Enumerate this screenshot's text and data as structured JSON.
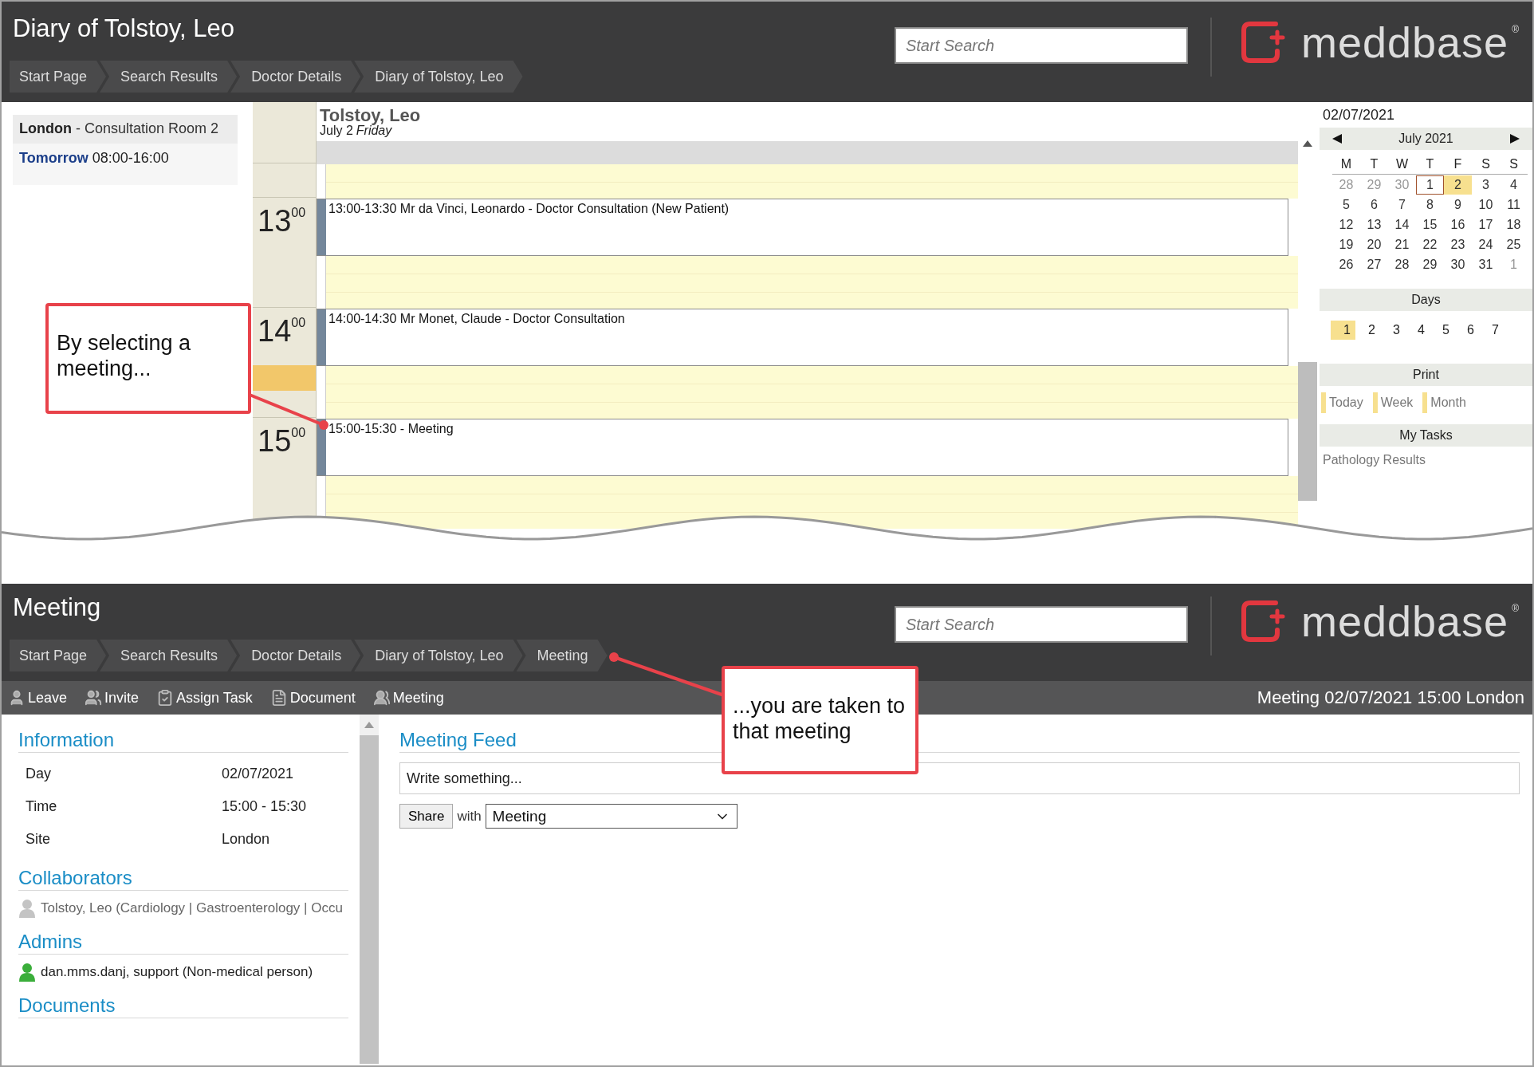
{
  "diary": {
    "title": "Diary of Tolstoy, Leo",
    "breadcrumbs": [
      "Start Page",
      "Search Results",
      "Doctor Details",
      "Diary of Tolstoy, Leo"
    ],
    "search": {
      "placeholder": "Start Search"
    },
    "logo": {
      "text": "meddbase",
      "mark": "®"
    },
    "location": {
      "site": "London",
      "room": "- Consultation Room 2"
    },
    "availability": {
      "day": "Tomorrow",
      "hours": "08:00-16:00"
    },
    "doctor": {
      "name": "Tolstoy, Leo",
      "date": "July 2",
      "weekday": "Friday"
    },
    "hours": [
      {
        "hour": "13",
        "minutes": "00",
        "slots": [
          {
            "appointment": "13:00-13:30 Mr da Vinci, Leonardo - Doctor Consultation (New Patient)",
            "current": false
          },
          {
            "current": false
          }
        ]
      },
      {
        "hour": "14",
        "minutes": "00",
        "slots": [
          {
            "appointment": "14:00-14:30 Mr Monet, Claude - Doctor Consultation",
            "current": false
          },
          {
            "current": true
          }
        ]
      },
      {
        "hour": "15",
        "minutes": "00",
        "slots": [
          {
            "appointment": "15:00-15:30 - Meeting",
            "current": false
          },
          {
            "current": false
          }
        ]
      }
    ],
    "calendar": {
      "date": "02/07/2021",
      "month": "July 2021",
      "weekdays": [
        "M",
        "T",
        "W",
        "T",
        "F",
        "S",
        "S"
      ],
      "weeks": [
        {
          "days": [
            {
              "day": "28",
              "other_month": true,
              "today": false,
              "selected": false
            },
            {
              "day": "29",
              "other_month": true,
              "today": false,
              "selected": false
            },
            {
              "day": "30",
              "other_month": true,
              "today": false,
              "selected": false
            },
            {
              "day": "1",
              "other_month": false,
              "today": true,
              "selected": false
            },
            {
              "day": "2",
              "other_month": false,
              "today": false,
              "selected": true
            },
            {
              "day": "3",
              "other_month": false,
              "today": false,
              "selected": false
            },
            {
              "day": "4",
              "other_month": false,
              "today": false,
              "selected": false
            }
          ]
        },
        {
          "days": [
            {
              "day": "5",
              "other_month": false,
              "today": false,
              "selected": false
            },
            {
              "day": "6",
              "other_month": false,
              "today": false,
              "selected": false
            },
            {
              "day": "7",
              "other_month": false,
              "today": false,
              "selected": false
            },
            {
              "day": "8",
              "other_month": false,
              "today": false,
              "selected": false
            },
            {
              "day": "9",
              "other_month": false,
              "today": false,
              "selected": false
            },
            {
              "day": "10",
              "other_month": false,
              "today": false,
              "selected": false
            },
            {
              "day": "11",
              "other_month": false,
              "today": false,
              "selected": false
            }
          ]
        },
        {
          "days": [
            {
              "day": "12",
              "other_month": false,
              "today": false,
              "selected": false
            },
            {
              "day": "13",
              "other_month": false,
              "today": false,
              "selected": false
            },
            {
              "day": "14",
              "other_month": false,
              "today": false,
              "selected": false
            },
            {
              "day": "15",
              "other_month": false,
              "today": false,
              "selected": false
            },
            {
              "day": "16",
              "other_month": false,
              "today": false,
              "selected": false
            },
            {
              "day": "17",
              "other_month": false,
              "today": false,
              "selected": false
            },
            {
              "day": "18",
              "other_month": false,
              "today": false,
              "selected": false
            }
          ]
        },
        {
          "days": [
            {
              "day": "19",
              "other_month": false,
              "today": false,
              "selected": false
            },
            {
              "day": "20",
              "other_month": false,
              "today": false,
              "selected": false
            },
            {
              "day": "21",
              "other_month": false,
              "today": false,
              "selected": false
            },
            {
              "day": "22",
              "other_month": false,
              "today": false,
              "selected": false
            },
            {
              "day": "23",
              "other_month": false,
              "today": false,
              "selected": false
            },
            {
              "day": "24",
              "other_month": false,
              "today": false,
              "selected": false
            },
            {
              "day": "25",
              "other_month": false,
              "today": false,
              "selected": false
            }
          ]
        },
        {
          "days": [
            {
              "day": "26",
              "other_month": false,
              "today": false,
              "selected": false
            },
            {
              "day": "27",
              "other_month": false,
              "today": false,
              "selected": false
            },
            {
              "day": "28",
              "other_month": false,
              "today": false,
              "selected": false
            },
            {
              "day": "29",
              "other_month": false,
              "today": false,
              "selected": false
            },
            {
              "day": "30",
              "other_month": false,
              "today": false,
              "selected": false
            },
            {
              "day": "31",
              "other_month": false,
              "today": false,
              "selected": false
            },
            {
              "day": "1",
              "other_month": true,
              "today": false,
              "selected": false
            }
          ]
        }
      ]
    },
    "days": {
      "label": "Days",
      "options": [
        {
          "label": "1",
          "selected": true
        },
        {
          "label": "2",
          "selected": false
        },
        {
          "label": "3",
          "selected": false
        },
        {
          "label": "4",
          "selected": false
        },
        {
          "label": "5",
          "selected": false
        },
        {
          "label": "6",
          "selected": false
        },
        {
          "label": "7",
          "selected": false
        }
      ]
    },
    "print": {
      "label": "Print",
      "options": [
        "Today",
        "Week",
        "Month"
      ]
    },
    "tasks": {
      "label": "My Tasks",
      "items": [
        "Pathology Results"
      ]
    }
  },
  "meeting": {
    "title": "Meeting",
    "breadcrumbs": [
      "Start Page",
      "Search Results",
      "Doctor Details",
      "Diary of Tolstoy, Leo",
      "Meeting"
    ],
    "search": {
      "placeholder": "Start Search"
    },
    "logo": {
      "text": "meddbase",
      "mark": "®"
    },
    "toolbar": [
      {
        "label": "Leave",
        "kind": "person"
      },
      {
        "label": "Invite",
        "kind": "people"
      },
      {
        "label": "Assign Task",
        "kind": "task"
      },
      {
        "label": "Document",
        "kind": "document"
      },
      {
        "label": "Meeting",
        "kind": "group"
      }
    ],
    "toolbar_title": "Meeting 02/07/2021 15:00 London",
    "information": {
      "heading": "Information",
      "rows": [
        {
          "label": "Day",
          "value": "02/07/2021"
        },
        {
          "label": "Time",
          "value": "15:00 - 15:30"
        },
        {
          "label": "Site",
          "value": "London"
        }
      ]
    },
    "collaborators": {
      "heading": "Collaborators",
      "people": [
        {
          "name": "Tolstoy, Leo (Cardiology | Gastroenterology | Occu",
          "color": "#c4c4c4"
        }
      ]
    },
    "admins": {
      "heading": "Admins",
      "people": [
        {
          "name": "dan.mms.danj, support (Non-medical person)",
          "color": "#3aae3a"
        }
      ]
    },
    "documents": {
      "heading": "Documents"
    },
    "feed": {
      "heading": "Meeting Feed",
      "placeholder": "Write something...",
      "share": "Share",
      "with": "with",
      "audience": "Meeting"
    }
  },
  "callouts": [
    {
      "text": "By selecting a meeting..."
    },
    {
      "text": "...you are taken to that meeting"
    }
  ]
}
